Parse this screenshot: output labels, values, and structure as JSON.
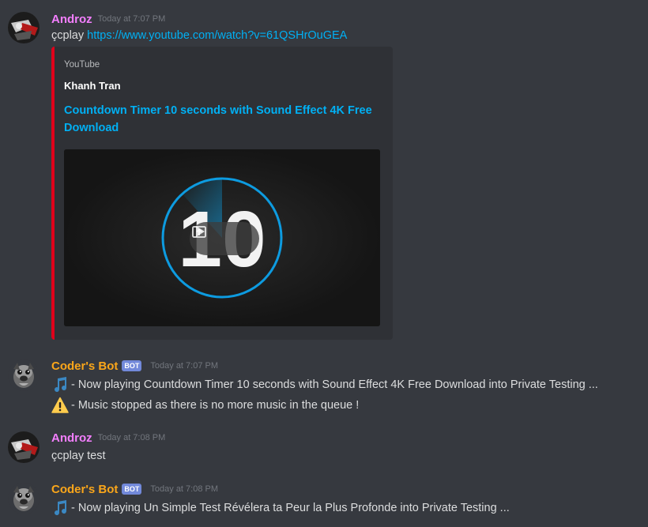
{
  "messages": [
    {
      "author": "Androz",
      "author_color": "#f47fff",
      "timestamp": "Today at 7:07 PM",
      "avatar_icon": "androz-avatar",
      "content_prefix": "çcplay ",
      "content_link": "https://www.youtube.com/watch?v=61QSHrOuGEA",
      "embed": {
        "provider": "YouTube",
        "author": "Khanh Tran",
        "title": "Countdown Timer 10 seconds with Sound Effect 4K Free Download",
        "border_color": "#e0001b",
        "thumbnail_text": "10",
        "play_icon": "play-icon",
        "external_icon": "open-external-icon"
      }
    },
    {
      "author": "Coder's Bot",
      "author_color": "#faa61a",
      "bot_tag": "BOT",
      "timestamp": "Today at 7:07 PM",
      "avatar_icon": "bot-avatar",
      "lines": [
        {
          "icon": "music-note-icon",
          "text": "- Now playing Countdown Timer 10 seconds with Sound Effect 4K Free Download into Private Testing ..."
        },
        {
          "icon": "warning-icon",
          "text": "- Music stopped as there is no more music in the queue !"
        }
      ]
    },
    {
      "author": "Androz",
      "author_color": "#f47fff",
      "timestamp": "Today at 7:08 PM",
      "avatar_icon": "androz-avatar",
      "content": "çcplay test"
    },
    {
      "author": "Coder's Bot",
      "author_color": "#faa61a",
      "bot_tag": "BOT",
      "timestamp": "Today at 7:08 PM",
      "avatar_icon": "bot-avatar",
      "lines": [
        {
          "icon": "music-note-icon",
          "text": "- Now playing Un Simple Test Révélera ta Peur la Plus Profonde into Private Testing ..."
        }
      ]
    }
  ],
  "colors": {
    "background": "#36393f",
    "embed_background": "#2f3136",
    "link": "#00b0f4",
    "timestamp": "#72767d",
    "bot_tag": "#7289da"
  }
}
